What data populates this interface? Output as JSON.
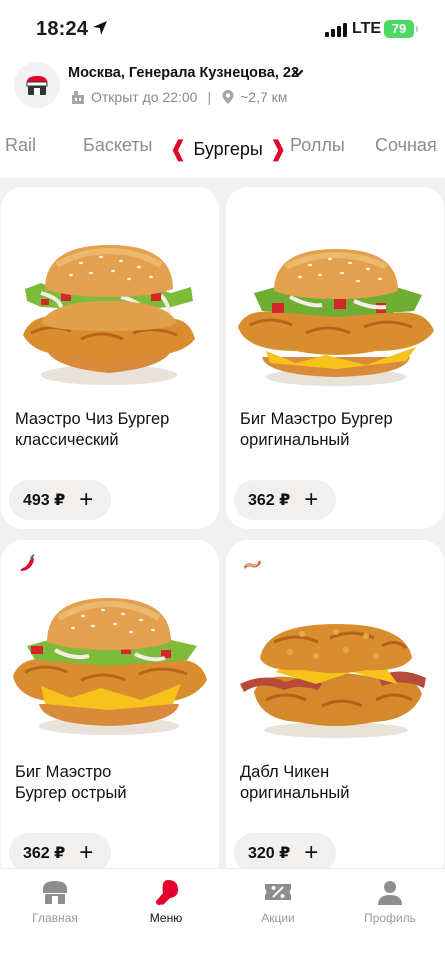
{
  "status_bar": {
    "time": "18:24",
    "network": "LTE",
    "battery": "79"
  },
  "header": {
    "address": "Москва, Генерала Кузнецова, 22",
    "hours": "Открыт до 22:00",
    "separator": "|",
    "distance": "~2,7 км"
  },
  "categories": [
    {
      "label": "r Rail",
      "active": false
    },
    {
      "label": "Баскеты",
      "active": false
    },
    {
      "label": "Бургеры",
      "active": true
    },
    {
      "label": "Роллы",
      "active": false
    },
    {
      "label": "Сочная",
      "active": false
    }
  ],
  "products": [
    {
      "name_line1": "Маэстро Чиз Бургер",
      "name_line2": "классический",
      "price": "493 ₽",
      "badge": ""
    },
    {
      "name_line1": "Биг Маэстро Бургер",
      "name_line2": "оригинальный",
      "price": "362 ₽",
      "badge": ""
    },
    {
      "name_line1": "Биг Маэстро",
      "name_line2": "Бургер острый",
      "price": "362 ₽",
      "badge": "chili-pepper-icon"
    },
    {
      "name_line1": "Дабл Чикен",
      "name_line2": "оригинальный",
      "price": "320 ₽",
      "badge": "bacon-icon"
    }
  ],
  "add_symbol": "+",
  "nav": [
    {
      "label": "Главная",
      "icon": "store-icon",
      "active": false
    },
    {
      "label": "Меню",
      "icon": "drumstick-icon",
      "active": true
    },
    {
      "label": "Акции",
      "icon": "coupon-icon",
      "active": false
    },
    {
      "label": "Профиль",
      "icon": "profile-icon",
      "active": false
    }
  ],
  "colors": {
    "accent": "#e4002b",
    "background": "#f1f1f1",
    "inactive": "#8c8c8c",
    "battery": "#4cd964"
  }
}
